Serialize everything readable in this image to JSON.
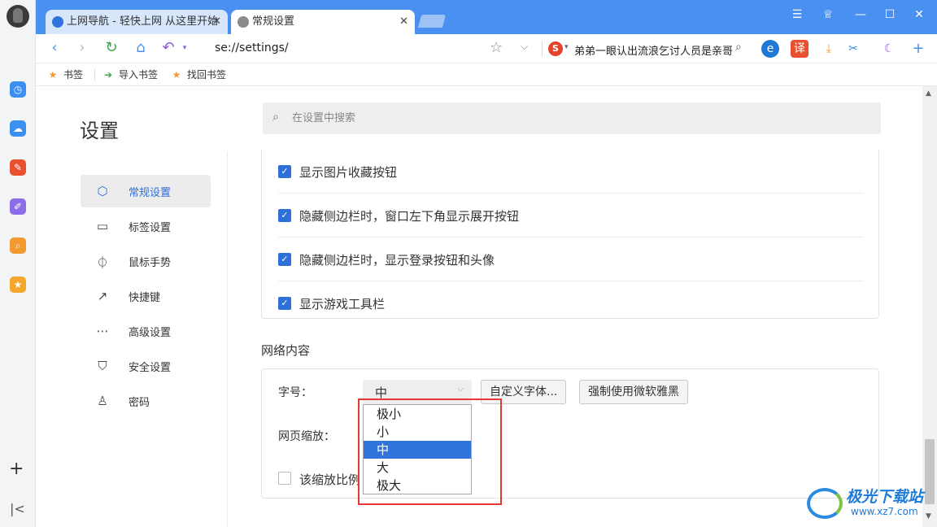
{
  "colors": {
    "accent": "#2f6fd8",
    "tabbar": "#4a90f0",
    "highlight": "#e53935"
  },
  "tabs": [
    {
      "label": "上网导航 - 轻快上网 从这里开始",
      "icon": "sogou-logo-icon"
    },
    {
      "label": "常规设置",
      "icon": "settings-gear-icon"
    }
  ],
  "toolbar": {
    "url": "se://settings/",
    "news_text": "弟弟一眼认出流浪乞讨人员是亲哥",
    "extensions": {
      "translate": "译"
    }
  },
  "bookmarks": [
    {
      "label": "书签",
      "icon": "star-icon"
    },
    {
      "label": "导入书签",
      "icon": "import-icon"
    },
    {
      "label": "找回书签",
      "icon": "star-icon"
    }
  ],
  "settings": {
    "title": "设置",
    "search_placeholder": "在设置中搜索",
    "nav": [
      {
        "label": "常规设置",
        "icon": "hexagon-icon",
        "active": true
      },
      {
        "label": "标签设置",
        "icon": "tab-icon"
      },
      {
        "label": "鼠标手势",
        "icon": "mouse-icon"
      },
      {
        "label": "快捷键",
        "icon": "shortcut-arrow-icon"
      },
      {
        "label": "高级设置",
        "icon": "more-circle-icon"
      },
      {
        "label": "安全设置",
        "icon": "shield-icon"
      },
      {
        "label": "密码",
        "icon": "user-icon"
      }
    ],
    "checkboxes": [
      {
        "label": "显示图片收藏按钮",
        "checked": true
      },
      {
        "label": "隐藏侧边栏时，窗口左下角显示展开按钮",
        "checked": true
      },
      {
        "label": "隐藏侧边栏时，显示登录按钮和头像",
        "checked": true
      },
      {
        "label": "显示游戏工具栏",
        "checked": true
      }
    ],
    "web_content": {
      "section_title": "网络内容",
      "font_size_label": "字号：",
      "font_size_value": "中",
      "custom_font_button": "自定义字体...",
      "force_font_button": "强制使用微软雅黑",
      "zoom_label": "网页缩放：",
      "zoom_checkbox_label": "该缩放比例",
      "font_size_options": [
        "极小",
        "小",
        "中",
        "大",
        "极大"
      ],
      "selected_option": "中"
    }
  },
  "watermark": {
    "title": "极光下载站",
    "url": "www.xz7.com"
  }
}
